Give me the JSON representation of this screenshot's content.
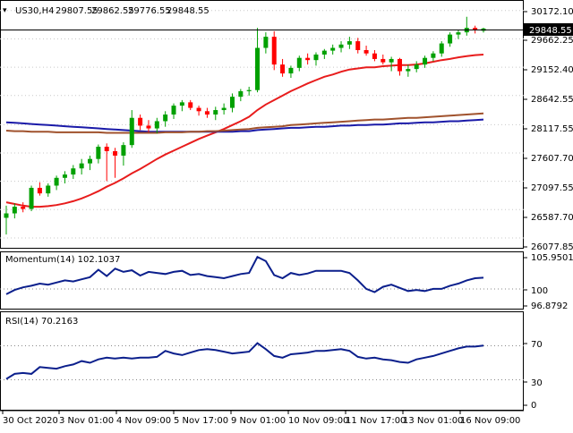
{
  "header": {
    "symbol": "US30,H4",
    "ohlc": [
      "29807.55",
      "29862.55",
      "29776.55",
      "29848.55"
    ]
  },
  "price_axis": {
    "ticks": [
      "30172.10",
      "29662.25",
      "29152.40",
      "28642.55",
      "28117.55",
      "27607.70",
      "27097.55",
      "26587.70",
      "26077.85"
    ],
    "current_price_label": "29848.55"
  },
  "momentum_panel": {
    "label": "Momentum(14) 102.1037",
    "ticks": [
      "105.9501",
      "100",
      "96.8792"
    ]
  },
  "rsi_panel": {
    "label": "RSI(14) 70.2163",
    "ticks": [
      "70",
      "30",
      "0"
    ]
  },
  "time_axis": {
    "ticks": [
      "30 Oct 2020",
      "3 Nov 01:00",
      "4 Nov 09:00",
      "5 Nov 17:00",
      "9 Nov 01:00",
      "10 Nov 09:00",
      "11 Nov 17:00",
      "13 Nov 01:00",
      "16 Nov 09:00"
    ]
  },
  "colors": {
    "bull": "#00a000",
    "bear": "#ff0000",
    "ma_red": "#e81c1c",
    "ma_blue": "#1a1aa8",
    "ma_brown": "#a0522d",
    "indicator_line": "#0b1f8c",
    "grid": "#c8c8c8"
  },
  "chart_data": [
    {
      "type": "candlestick",
      "title": "US30,H4",
      "ylim": [
        25900,
        30330
      ],
      "candles": [
        [
          26440,
          26660,
          26140,
          26520
        ],
        [
          26520,
          26700,
          26430,
          26640
        ],
        [
          26640,
          26720,
          26540,
          26600
        ],
        [
          26600,
          27020,
          26560,
          26980
        ],
        [
          26980,
          27080,
          26840,
          26880
        ],
        [
          26880,
          27060,
          26820,
          27020
        ],
        [
          27020,
          27200,
          26940,
          27160
        ],
        [
          27160,
          27280,
          27060,
          27220
        ],
        [
          27220,
          27390,
          27140,
          27330
        ],
        [
          27330,
          27500,
          27220,
          27420
        ],
        [
          27420,
          27560,
          27300,
          27500
        ],
        [
          27500,
          27760,
          27420,
          27720
        ],
        [
          27720,
          27780,
          27100,
          27640
        ],
        [
          27640,
          27700,
          27160,
          27560
        ],
        [
          27560,
          27800,
          27380,
          27750
        ],
        [
          27750,
          28380,
          27700,
          28240
        ],
        [
          28240,
          28300,
          28020,
          28100
        ],
        [
          28100,
          28200,
          27980,
          28050
        ],
        [
          28050,
          28240,
          27960,
          28180
        ],
        [
          28180,
          28360,
          28080,
          28300
        ],
        [
          28300,
          28500,
          28220,
          28460
        ],
        [
          28460,
          28560,
          28360,
          28520
        ],
        [
          28520,
          28560,
          28380,
          28420
        ],
        [
          28420,
          28460,
          28280,
          28360
        ],
        [
          28360,
          28420,
          28240,
          28300
        ],
        [
          28300,
          28440,
          28200,
          28380
        ],
        [
          28380,
          28500,
          28300,
          28420
        ],
        [
          28420,
          28680,
          28340,
          28620
        ],
        [
          28620,
          28760,
          28540,
          28720
        ],
        [
          28720,
          28800,
          28640,
          28740
        ],
        [
          28740,
          29860,
          28700,
          29500
        ],
        [
          29500,
          29780,
          29400,
          29700
        ],
        [
          29700,
          29800,
          29100,
          29200
        ],
        [
          29200,
          29300,
          28980,
          29040
        ],
        [
          29040,
          29180,
          28960,
          29140
        ],
        [
          29140,
          29360,
          29080,
          29320
        ],
        [
          29320,
          29400,
          29200,
          29280
        ],
        [
          29280,
          29420,
          29180,
          29380
        ],
        [
          29380,
          29480,
          29300,
          29450
        ],
        [
          29450,
          29560,
          29380,
          29500
        ],
        [
          29500,
          29620,
          29420,
          29560
        ],
        [
          29560,
          29700,
          29480,
          29620
        ],
        [
          29620,
          29680,
          29400,
          29460
        ],
        [
          29460,
          29540,
          29360,
          29400
        ],
        [
          29400,
          29460,
          29260,
          29300
        ],
        [
          29300,
          29380,
          29200,
          29240
        ],
        [
          29240,
          29340,
          29080,
          29300
        ],
        [
          29300,
          29320,
          29000,
          29080
        ],
        [
          29080,
          29200,
          28980,
          29120
        ],
        [
          29120,
          29260,
          29060,
          29200
        ],
        [
          29200,
          29360,
          29140,
          29320
        ],
        [
          29320,
          29440,
          29260,
          29400
        ],
        [
          29400,
          29620,
          29340,
          29580
        ],
        [
          29580,
          29780,
          29520,
          29740
        ],
        [
          29740,
          29820,
          29660,
          29780
        ],
        [
          29780,
          30060,
          29720,
          29860
        ],
        [
          29860,
          29900,
          29760,
          29820
        ],
        [
          29807.55,
          29862.55,
          29776.55,
          29848.55
        ]
      ],
      "series": [
        {
          "name": "MA red",
          "values": [
            26720,
            26690,
            26660,
            26640,
            26640,
            26650,
            26670,
            26700,
            26740,
            26790,
            26850,
            26920,
            27000,
            27070,
            27150,
            27240,
            27320,
            27410,
            27500,
            27580,
            27650,
            27720,
            27790,
            27860,
            27920,
            27980,
            28040,
            28110,
            28180,
            28260,
            28380,
            28480,
            28560,
            28640,
            28720,
            28790,
            28860,
            28920,
            28980,
            29020,
            29070,
            29110,
            29130,
            29150,
            29150,
            29170,
            29180,
            29190,
            29190,
            29200,
            29220,
            29250,
            29280,
            29300,
            29330,
            29350,
            29370,
            29380
          ]
        },
        {
          "name": "MA blue",
          "values": [
            28160,
            28150,
            28140,
            28130,
            28120,
            28110,
            28100,
            28090,
            28080,
            28070,
            28060,
            28050,
            28040,
            28030,
            28020,
            28010,
            28000,
            27990,
            27990,
            27990,
            27990,
            27990,
            27990,
            27990,
            27990,
            27990,
            27990,
            27990,
            28000,
            28000,
            28020,
            28030,
            28040,
            28050,
            28060,
            28060,
            28070,
            28080,
            28080,
            28090,
            28100,
            28100,
            28110,
            28110,
            28120,
            28120,
            28130,
            28140,
            28140,
            28150,
            28160,
            28160,
            28170,
            28180,
            28180,
            28190,
            28200,
            28210
          ]
        },
        {
          "name": "MA brown",
          "values": [
            28010,
            28000,
            28000,
            27990,
            27990,
            27990,
            27980,
            27980,
            27980,
            27980,
            27980,
            27980,
            27970,
            27970,
            27970,
            27970,
            27970,
            27970,
            27970,
            27980,
            27980,
            27980,
            27990,
            27990,
            28000,
            28000,
            28010,
            28020,
            28030,
            28040,
            28060,
            28070,
            28080,
            28090,
            28110,
            28120,
            28130,
            28140,
            28150,
            28160,
            28170,
            28180,
            28190,
            28200,
            28210,
            28210,
            28220,
            28230,
            28240,
            28240,
            28250,
            28260,
            28270,
            28280,
            28290,
            28300,
            28310,
            28320
          ]
        }
      ]
    },
    {
      "type": "line",
      "title": "Momentum(14) 102.1037",
      "ylim": [
        96.3,
        106.7
      ],
      "series": [
        {
          "name": "Momentum(14)",
          "values": [
            99.0,
            99.8,
            100.3,
            100.6,
            101.0,
            100.8,
            101.2,
            101.6,
            101.4,
            101.8,
            102.2,
            103.6,
            102.4,
            103.8,
            103.2,
            103.5,
            102.5,
            103.2,
            103.0,
            102.8,
            103.2,
            103.4,
            102.6,
            102.8,
            102.4,
            102.2,
            102.0,
            102.4,
            102.8,
            103.0,
            106.0,
            105.2,
            102.6,
            102.0,
            103.0,
            102.6,
            102.9,
            103.4,
            103.4,
            103.4,
            103.4,
            103.0,
            101.6,
            100.0,
            99.4,
            100.4,
            100.8,
            100.2,
            99.6,
            99.8,
            99.6,
            100.0,
            100.0,
            100.6,
            101.0,
            101.6,
            102.0,
            102.1037
          ]
        }
      ]
    },
    {
      "type": "line",
      "title": "RSI(14) 70.2163",
      "ylim": [
        0,
        100
      ],
      "series": [
        {
          "name": "RSI(14)",
          "values": [
            31,
            37,
            38,
            37,
            45,
            44,
            43,
            46,
            48,
            52,
            50,
            54,
            56,
            55,
            56,
            55,
            56,
            56,
            57,
            64,
            61,
            59,
            62,
            65,
            66,
            65,
            63,
            61,
            62,
            63,
            73,
            66,
            58,
            56,
            60,
            61,
            62,
            64,
            64,
            65,
            66,
            64,
            57,
            55,
            56,
            54,
            53,
            51,
            50,
            54,
            56,
            58,
            61,
            64,
            67,
            69,
            69,
            70.2163
          ]
        }
      ]
    }
  ]
}
